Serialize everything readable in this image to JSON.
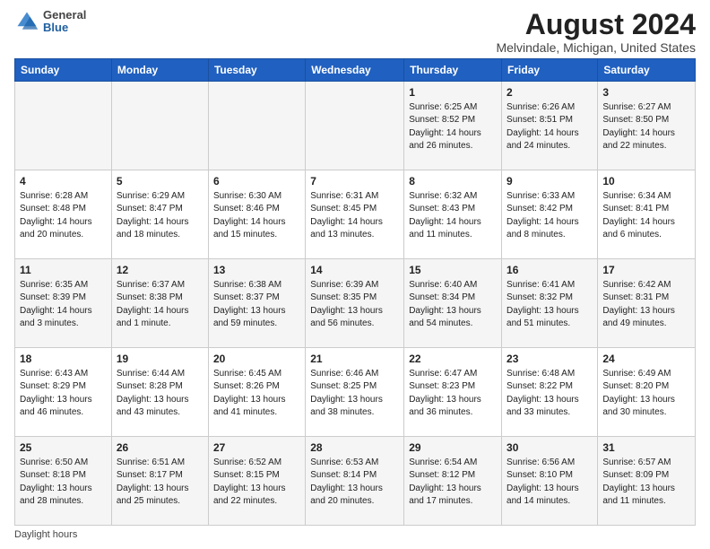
{
  "logo": {
    "general": "General",
    "blue": "Blue"
  },
  "title": "August 2024",
  "subtitle": "Melvindale, Michigan, United States",
  "days_of_week": [
    "Sunday",
    "Monday",
    "Tuesday",
    "Wednesday",
    "Thursday",
    "Friday",
    "Saturday"
  ],
  "footer": "Daylight hours",
  "weeks": [
    [
      {
        "num": "",
        "info": ""
      },
      {
        "num": "",
        "info": ""
      },
      {
        "num": "",
        "info": ""
      },
      {
        "num": "",
        "info": ""
      },
      {
        "num": "1",
        "info": "Sunrise: 6:25 AM\nSunset: 8:52 PM\nDaylight: 14 hours and 26 minutes."
      },
      {
        "num": "2",
        "info": "Sunrise: 6:26 AM\nSunset: 8:51 PM\nDaylight: 14 hours and 24 minutes."
      },
      {
        "num": "3",
        "info": "Sunrise: 6:27 AM\nSunset: 8:50 PM\nDaylight: 14 hours and 22 minutes."
      }
    ],
    [
      {
        "num": "4",
        "info": "Sunrise: 6:28 AM\nSunset: 8:48 PM\nDaylight: 14 hours and 20 minutes."
      },
      {
        "num": "5",
        "info": "Sunrise: 6:29 AM\nSunset: 8:47 PM\nDaylight: 14 hours and 18 minutes."
      },
      {
        "num": "6",
        "info": "Sunrise: 6:30 AM\nSunset: 8:46 PM\nDaylight: 14 hours and 15 minutes."
      },
      {
        "num": "7",
        "info": "Sunrise: 6:31 AM\nSunset: 8:45 PM\nDaylight: 14 hours and 13 minutes."
      },
      {
        "num": "8",
        "info": "Sunrise: 6:32 AM\nSunset: 8:43 PM\nDaylight: 14 hours and 11 minutes."
      },
      {
        "num": "9",
        "info": "Sunrise: 6:33 AM\nSunset: 8:42 PM\nDaylight: 14 hours and 8 minutes."
      },
      {
        "num": "10",
        "info": "Sunrise: 6:34 AM\nSunset: 8:41 PM\nDaylight: 14 hours and 6 minutes."
      }
    ],
    [
      {
        "num": "11",
        "info": "Sunrise: 6:35 AM\nSunset: 8:39 PM\nDaylight: 14 hours and 3 minutes."
      },
      {
        "num": "12",
        "info": "Sunrise: 6:37 AM\nSunset: 8:38 PM\nDaylight: 14 hours and 1 minute."
      },
      {
        "num": "13",
        "info": "Sunrise: 6:38 AM\nSunset: 8:37 PM\nDaylight: 13 hours and 59 minutes."
      },
      {
        "num": "14",
        "info": "Sunrise: 6:39 AM\nSunset: 8:35 PM\nDaylight: 13 hours and 56 minutes."
      },
      {
        "num": "15",
        "info": "Sunrise: 6:40 AM\nSunset: 8:34 PM\nDaylight: 13 hours and 54 minutes."
      },
      {
        "num": "16",
        "info": "Sunrise: 6:41 AM\nSunset: 8:32 PM\nDaylight: 13 hours and 51 minutes."
      },
      {
        "num": "17",
        "info": "Sunrise: 6:42 AM\nSunset: 8:31 PM\nDaylight: 13 hours and 49 minutes."
      }
    ],
    [
      {
        "num": "18",
        "info": "Sunrise: 6:43 AM\nSunset: 8:29 PM\nDaylight: 13 hours and 46 minutes."
      },
      {
        "num": "19",
        "info": "Sunrise: 6:44 AM\nSunset: 8:28 PM\nDaylight: 13 hours and 43 minutes."
      },
      {
        "num": "20",
        "info": "Sunrise: 6:45 AM\nSunset: 8:26 PM\nDaylight: 13 hours and 41 minutes."
      },
      {
        "num": "21",
        "info": "Sunrise: 6:46 AM\nSunset: 8:25 PM\nDaylight: 13 hours and 38 minutes."
      },
      {
        "num": "22",
        "info": "Sunrise: 6:47 AM\nSunset: 8:23 PM\nDaylight: 13 hours and 36 minutes."
      },
      {
        "num": "23",
        "info": "Sunrise: 6:48 AM\nSunset: 8:22 PM\nDaylight: 13 hours and 33 minutes."
      },
      {
        "num": "24",
        "info": "Sunrise: 6:49 AM\nSunset: 8:20 PM\nDaylight: 13 hours and 30 minutes."
      }
    ],
    [
      {
        "num": "25",
        "info": "Sunrise: 6:50 AM\nSunset: 8:18 PM\nDaylight: 13 hours and 28 minutes."
      },
      {
        "num": "26",
        "info": "Sunrise: 6:51 AM\nSunset: 8:17 PM\nDaylight: 13 hours and 25 minutes."
      },
      {
        "num": "27",
        "info": "Sunrise: 6:52 AM\nSunset: 8:15 PM\nDaylight: 13 hours and 22 minutes."
      },
      {
        "num": "28",
        "info": "Sunrise: 6:53 AM\nSunset: 8:14 PM\nDaylight: 13 hours and 20 minutes."
      },
      {
        "num": "29",
        "info": "Sunrise: 6:54 AM\nSunset: 8:12 PM\nDaylight: 13 hours and 17 minutes."
      },
      {
        "num": "30",
        "info": "Sunrise: 6:56 AM\nSunset: 8:10 PM\nDaylight: 13 hours and 14 minutes."
      },
      {
        "num": "31",
        "info": "Sunrise: 6:57 AM\nSunset: 8:09 PM\nDaylight: 13 hours and 11 minutes."
      }
    ]
  ]
}
